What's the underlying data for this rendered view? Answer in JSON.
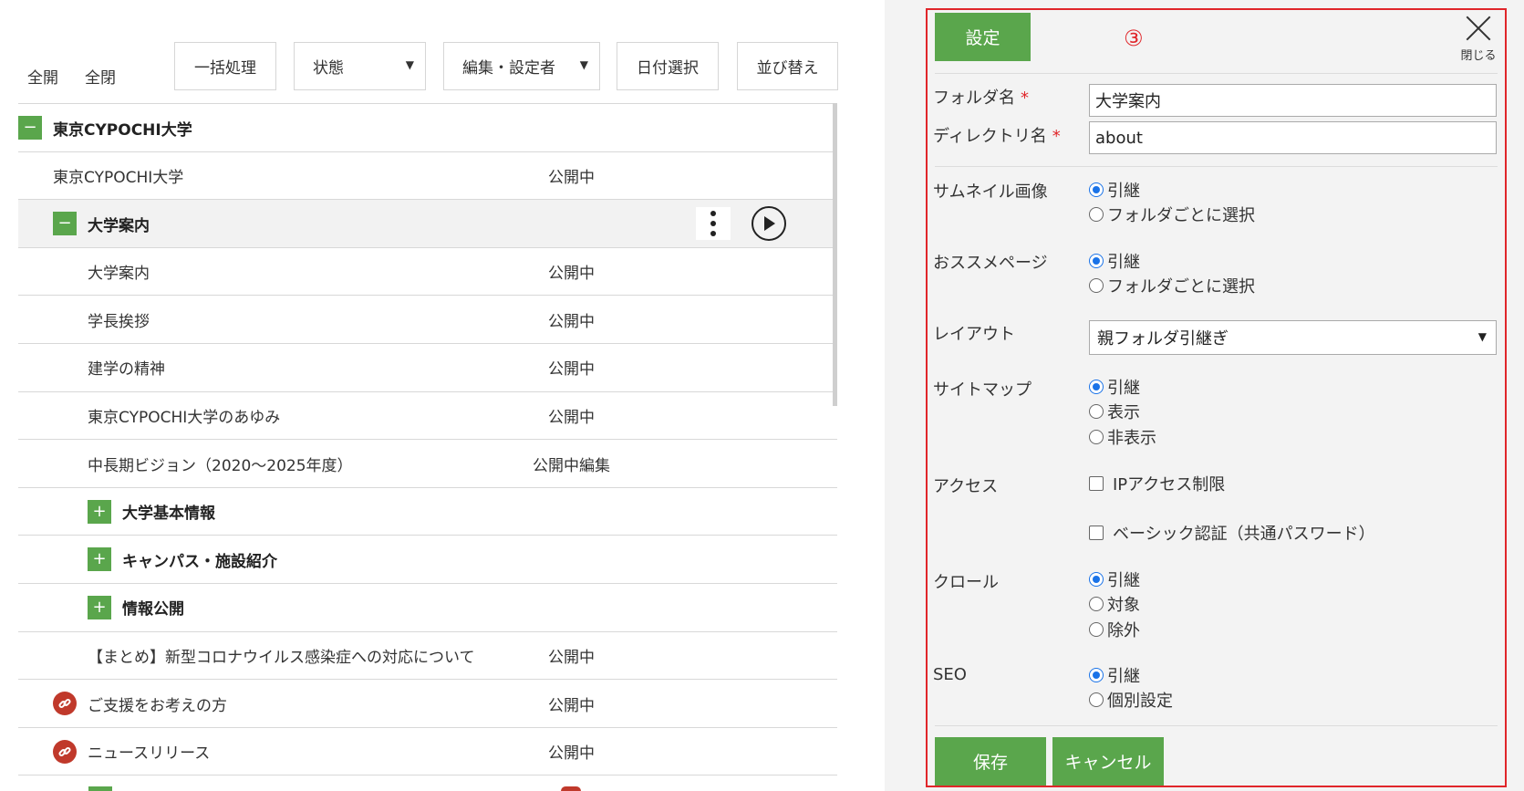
{
  "toolbar": {
    "expand_all": "全開",
    "collapse_all": "全閉",
    "bulk": "一括処理",
    "status": "状態",
    "editor": "編集・設定者",
    "date": "日付選択",
    "sort": "並び替え"
  },
  "tree": {
    "root": {
      "toggle": "−",
      "label": "東京CYPOCHI大学"
    },
    "rows": [
      {
        "label": "東京CYPOCHI大学",
        "status": "公開中"
      },
      {
        "toggle": "−",
        "label": "大学案内"
      },
      {
        "label": "大学案内",
        "status": "公開中"
      },
      {
        "label": "学長挨拶",
        "status": "公開中"
      },
      {
        "label": "建学の精神",
        "status": "公開中"
      },
      {
        "label": "東京CYPOCHI大学のあゆみ",
        "status": "公開中"
      },
      {
        "label": "中長期ビジョン（2020～2025年度）",
        "status": "公開中編集"
      },
      {
        "toggle": "+",
        "label": "大学基本情報"
      },
      {
        "toggle": "+",
        "label": "キャンパス・施設紹介"
      },
      {
        "toggle": "+",
        "label": "情報公開"
      },
      {
        "label": "【まとめ】新型コロナウイルス感染症への対応について",
        "status": "公開中"
      },
      {
        "icon": "link-icon",
        "label": "ご支援をお考えの方",
        "status": "公開中"
      },
      {
        "icon": "link-icon",
        "label": "ニュースリリース",
        "status": "公開中"
      }
    ]
  },
  "panel": {
    "tab": "設定",
    "step": "③",
    "close": "閉じる",
    "folder_name": {
      "label": "フォルダ名",
      "req": "*",
      "value": "大学案内"
    },
    "dir_name": {
      "label": "ディレクトリ名",
      "req": "*",
      "value": "about"
    },
    "thumbnail": {
      "label": "サムネイル画像",
      "opt1": "引継",
      "opt2": "フォルダごとに選択"
    },
    "recommend": {
      "label": "おススメページ",
      "opt1": "引継",
      "opt2": "フォルダごとに選択"
    },
    "layout": {
      "label": "レイアウト",
      "value": "親フォルダ引継ぎ"
    },
    "sitemap": {
      "label": "サイトマップ",
      "opt1": "引継",
      "opt2": "表示",
      "opt3": "非表示"
    },
    "access": {
      "label": "アクセス",
      "cb1": "IPアクセス制限",
      "cb2": "ベーシック認証（共通パスワード）"
    },
    "crawl": {
      "label": "クロール",
      "opt1": "引継",
      "opt2": "対象",
      "opt3": "除外"
    },
    "seo": {
      "label": "SEO",
      "opt1": "引継",
      "opt2": "個別設定"
    },
    "save": "保存",
    "cancel": "キャンセル"
  }
}
